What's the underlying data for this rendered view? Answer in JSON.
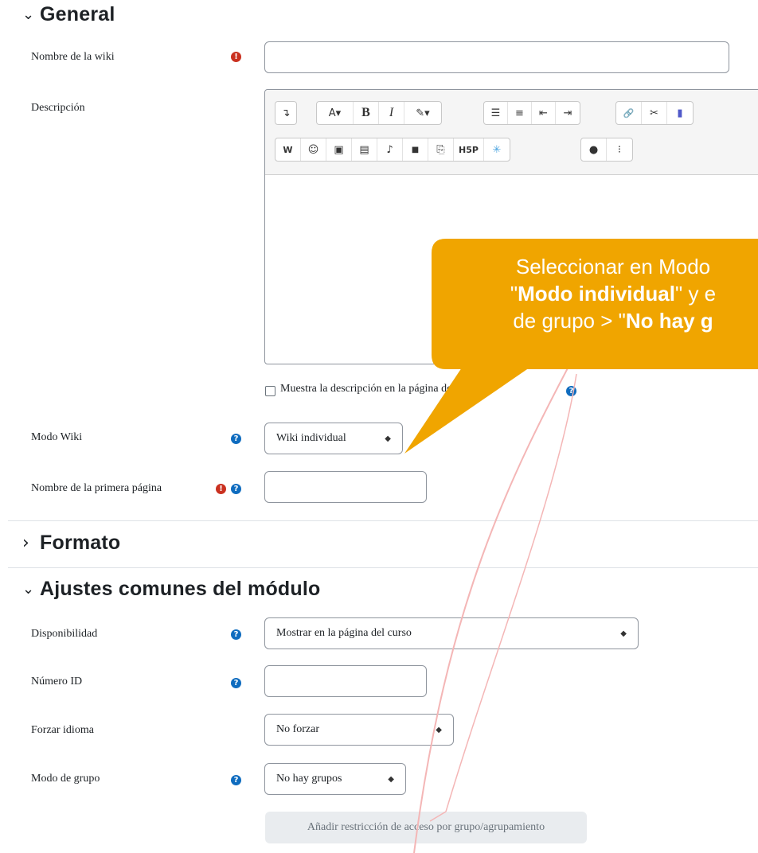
{
  "sections": {
    "general": {
      "title": "General",
      "chevron": "⌄"
    },
    "formato": {
      "title": "Formato",
      "chevron": "›"
    },
    "ajustes": {
      "title": "Ajustes comunes del módulo",
      "chevron": "⌄"
    }
  },
  "fields": {
    "nombre_wiki": {
      "label": "Nombre de la wiki",
      "value": ""
    },
    "descripcion": {
      "label": "Descripción"
    },
    "mostrar_descripcion": {
      "label": "Muestra la descripción en la página del curso",
      "checked": false
    },
    "modo_wiki": {
      "label": "Modo Wiki",
      "value": "Wiki individual"
    },
    "primera_pagina": {
      "label": "Nombre de la primera página",
      "value": ""
    },
    "disponibilidad": {
      "label": "Disponibilidad",
      "value": "Mostrar en la página del curso"
    },
    "numero_id": {
      "label": "Número ID",
      "value": ""
    },
    "forzar_idioma": {
      "label": "Forzar idioma",
      "value": "No forzar"
    },
    "modo_grupo": {
      "label": "Modo de grupo",
      "value": "No hay grupos"
    }
  },
  "buttons": {
    "restriccion": "Añadir restricción de acceso por grupo/agrupamiento"
  },
  "toolbar": {
    "row1": [
      [
        "collapse-icon"
      ],
      [
        "font-size-icon",
        "bold-icon",
        "italic-icon",
        "text-color-icon"
      ],
      [
        "bullet-list-icon",
        "numbered-list-icon",
        "outdent-icon",
        "indent-icon"
      ],
      [
        "link-icon",
        "unlink-icon",
        "teams-icon"
      ]
    ],
    "row2": [
      [
        "word-icon",
        "emoji-icon",
        "image-icon",
        "media-file-icon",
        "microphone-icon",
        "video-icon",
        "manage-files-icon",
        "h5p-icon",
        "sparkle-icon"
      ],
      [
        "accessibility-icon",
        "screenreader-icon"
      ]
    ],
    "glyphs": {
      "collapse": "↴",
      "font_size": "A▾",
      "bold": "B",
      "italic": "I",
      "text_color": "✎▾",
      "bullet_list": "☰",
      "numbered_list": "≡",
      "outdent": "⇤",
      "indent": "⇥",
      "link": "🔗",
      "unlink": "✂",
      "teams": "▮",
      "word": "W",
      "emoji": "☺",
      "image": "▣",
      "media_file": "▤",
      "microphone": "♪",
      "video": "■",
      "manage_files": "⎘",
      "h5p": "H5P",
      "sparkle": "✳",
      "accessibility": "●",
      "screenreader": "⁝"
    }
  },
  "callout": {
    "line1": "Seleccionar en Modo",
    "line2_bold": "Modo individual",
    "line2_rest": "\" y e",
    "line3_pre": "de grupo > \"",
    "line3_bold": "No hay g",
    "quote_open": "\"",
    "color": "#f0a500"
  },
  "colors": {
    "required": "#ca3120",
    "help": "#0f6cbf",
    "arrow": "#f4b6b6"
  }
}
